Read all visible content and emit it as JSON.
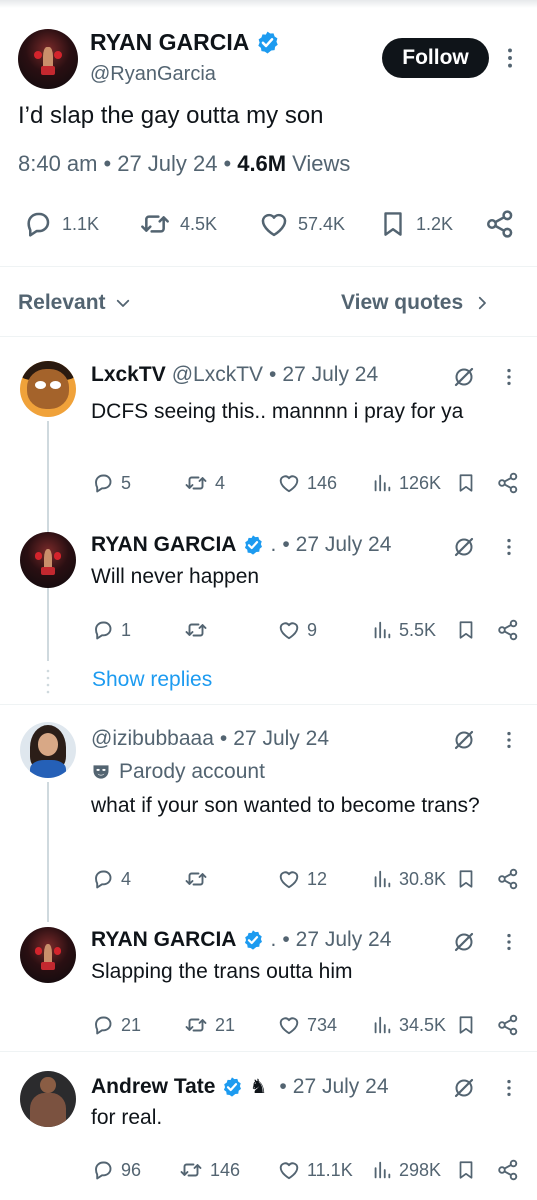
{
  "main_post": {
    "author_name": "RYAN GARCIA",
    "handle": "@RyanGarcia",
    "follow_label": "Follow",
    "text": "I’d slap the gay outta my son",
    "time": "8:40 am",
    "date": "27 July 24",
    "views_count": "4.6M",
    "views_label": "Views",
    "replies": "1.1K",
    "reposts": "4.5K",
    "likes": "57.4K",
    "bookmarks": "1.2K"
  },
  "filter_bar": {
    "sort_label": "Relevant",
    "quotes_label": "View quotes"
  },
  "replies": [
    {
      "name": "LxckTV",
      "handle": "@LxckTV",
      "date": "27 July 24",
      "text": "DCFS seeing this.. mannnn i pray for ya",
      "replies": "5",
      "reposts": "4",
      "likes": "146",
      "views": "126K"
    },
    {
      "name": "RYAN GARCIA",
      "handle": ".",
      "date": "27 July 24",
      "text": "Will never happen",
      "replies": "1",
      "reposts": "",
      "likes": "9",
      "views": "5.5K"
    },
    {
      "name": "",
      "handle": "@izibubbaaa",
      "date": "27 July 24",
      "parody_label": "Parody account",
      "text": "what if your son wanted to become trans?",
      "replies": "4",
      "reposts": "",
      "likes": "12",
      "views": "30.8K"
    },
    {
      "name": "RYAN GARCIA",
      "handle": ".",
      "date": "27 July 24",
      "text": "Slapping the trans outta him",
      "replies": "21",
      "reposts": "21",
      "likes": "734",
      "views": "34.5K"
    },
    {
      "name": "Andrew Tate",
      "handle": "",
      "date": "27 July 24",
      "text": "for real.",
      "replies": "96",
      "reposts": "146",
      "likes": "11.1K",
      "views": "298K"
    }
  ],
  "show_replies_label": "Show replies",
  "separator": "•",
  "colors": {
    "text": "#0f1419",
    "muted": "#536471",
    "link": "#1d9bf0",
    "verified": "#1d9bf0",
    "divider": "#eff3f4",
    "thread_line": "#cfd9de"
  },
  "icons": [
    "verified-badge-icon",
    "more-icon",
    "reply-icon",
    "repost-icon",
    "like-icon",
    "bookmark-icon",
    "share-icon",
    "views-icon",
    "grok-icon",
    "chevron-down-icon",
    "chevron-right-icon",
    "parody-mask-icon",
    "chess-knight-icon"
  ]
}
